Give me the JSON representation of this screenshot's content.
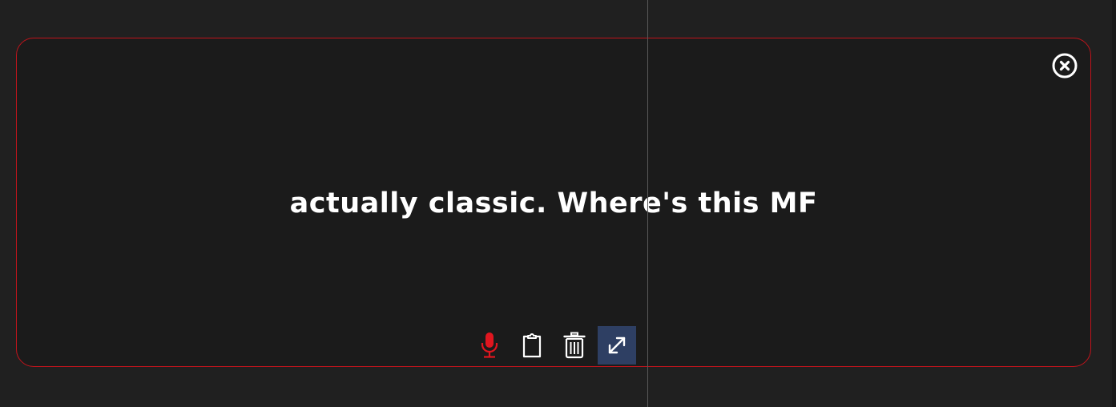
{
  "transcript": {
    "text": "actually classic. Where's this MF"
  },
  "colors": {
    "background": "#202020",
    "panel": "#1b1b1b",
    "panel_border": "#c0141c",
    "mic_active": "#e0161f",
    "expand_active_bg": "#2e3f63",
    "icon": "#ffffff"
  },
  "icons": {
    "close": "close-circle-icon",
    "mic": "microphone-icon",
    "clipboard": "clipboard-icon",
    "trash": "trash-icon",
    "expand": "expand-arrows-icon"
  }
}
